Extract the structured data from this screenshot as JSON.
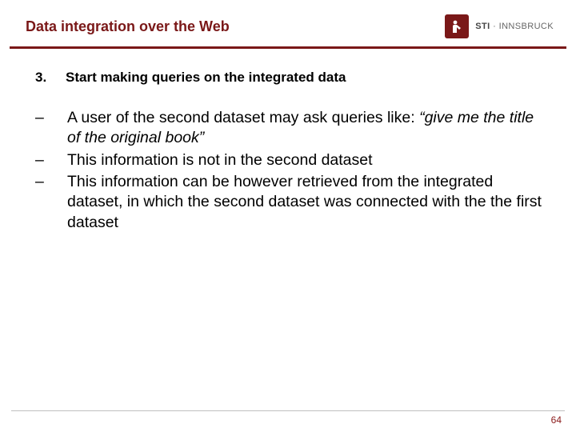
{
  "header": {
    "title": "Data integration over the Web",
    "logo": {
      "brand_bold": "STI",
      "brand_light": "INNSBRUCK",
      "icon": "sti-logo-icon"
    }
  },
  "content": {
    "ordered": {
      "number": "3.",
      "text": "Start making queries on the integrated data"
    },
    "bullets": [
      {
        "dash": "–",
        "text_prefix": "A user of the second dataset may ask queries like: ",
        "text_italic": "“give me the title of the original book”"
      },
      {
        "dash": "–",
        "text": "This information is not in the second dataset"
      },
      {
        "dash": "–",
        "text": "This information can be however retrieved from the integrated dataset, in which the second dataset was connected with the the first dataset"
      }
    ]
  },
  "footer": {
    "page": "64"
  }
}
